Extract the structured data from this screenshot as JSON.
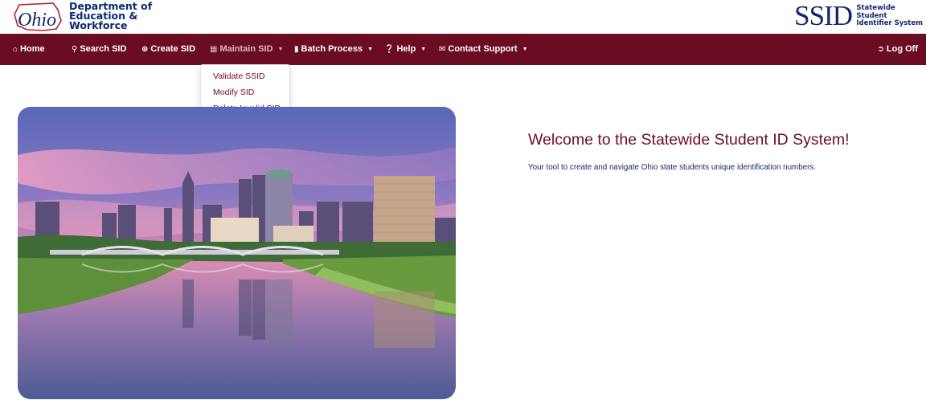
{
  "header": {
    "state_logo_text": "Ohio",
    "dept_lines": [
      "Department of",
      "Education &",
      "Workforce"
    ],
    "app_logo": "SSID",
    "app_logo_sub": [
      "Statewide",
      "Student",
      "Identifier System"
    ]
  },
  "nav": {
    "items": [
      {
        "label": "Home",
        "icon": "home-icon"
      },
      {
        "label": "Search SID",
        "icon": "search-icon"
      },
      {
        "label": "Create SID",
        "icon": "plus-circle-icon"
      },
      {
        "label": "Maintain SID",
        "icon": "calculator-icon",
        "dropdown": true
      },
      {
        "label": "Batch Process",
        "icon": "file-icon",
        "dropdown": true
      },
      {
        "label": "Help",
        "icon": "question-circle-icon",
        "dropdown": true
      },
      {
        "label": "Contact Support",
        "icon": "envelope-icon",
        "dropdown": true
      }
    ],
    "logoff_label": "Log Off",
    "logoff_icon": "sign-out-icon"
  },
  "maintain_menu": {
    "items": [
      "Validate SSID",
      "Modify SID",
      "Delete Invalid SID"
    ]
  },
  "main": {
    "hero_alt": "Columbus skyline",
    "welcome_title": "Welcome to the Statewide Student ID System!",
    "tagline": "Your tool to create and navigate Ohio state students unique identification numbers."
  },
  "colors": {
    "brand": "#6b0d22",
    "navy": "#12296b",
    "nav_text": "#ffffff"
  }
}
